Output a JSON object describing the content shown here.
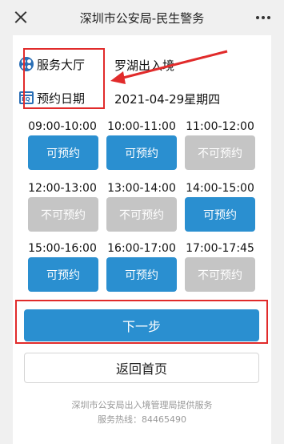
{
  "header": {
    "title": "深圳市公安局-民生警务",
    "close_icon": "close-icon",
    "more_icon": "more-dots-icon"
  },
  "info": {
    "hall_label": "服务大厅",
    "hall_value": "罗湖出入境",
    "date_label": "预约日期",
    "date_value": "2021-04-29星期四",
    "hall_icon": "hall-grid-icon",
    "date_icon": "calendar-icon"
  },
  "slots": [
    {
      "time": "09:00-10:00",
      "status": "可预约"
    },
    {
      "time": "10:00-11:00",
      "status": "可预约"
    },
    {
      "time": "11:00-12:00",
      "status": "不可预约"
    },
    {
      "time": "12:00-13:00",
      "status": "不可预约"
    },
    {
      "time": "13:00-14:00",
      "status": "不可预约"
    },
    {
      "time": "14:00-15:00",
      "status": "可预约"
    },
    {
      "time": "15:00-16:00",
      "status": "可预约"
    },
    {
      "time": "16:00-17:00",
      "status": "可预约"
    },
    {
      "time": "17:00-17:45",
      "status": "不可预约"
    }
  ],
  "actions": {
    "next_label": "下一步",
    "back_label": "返回首页"
  },
  "footer": {
    "provider": "深圳市公安局出入境管理局提供服务",
    "hotline": "服务热线：84465490"
  },
  "colors": {
    "accent": "#2a8fd0",
    "disabled": "#c5c5c5",
    "highlight": "#e12b2b"
  }
}
